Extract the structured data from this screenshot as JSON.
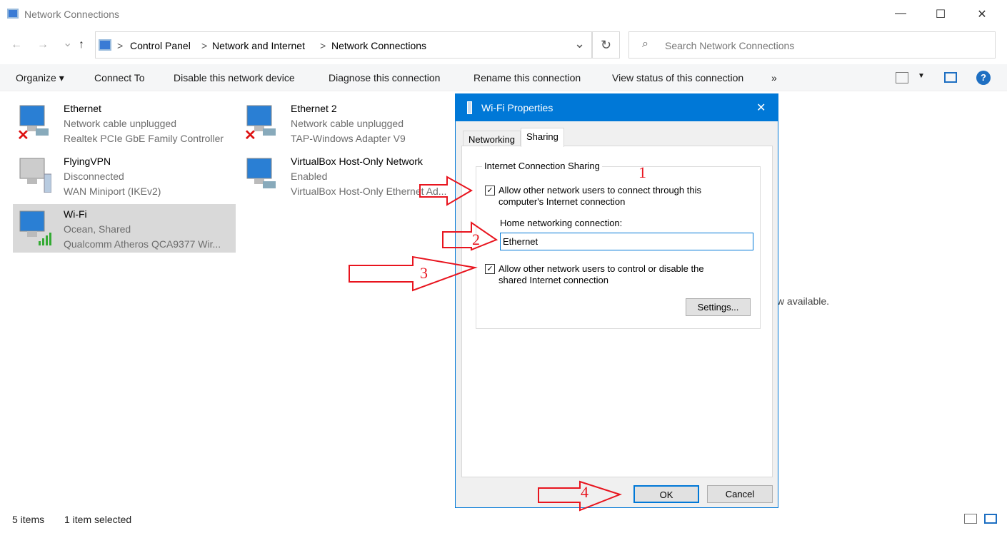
{
  "window": {
    "title": "Network Connections",
    "minimize": "—",
    "maximize": "☐",
    "close": "✕"
  },
  "nav": {
    "back": "←",
    "forward": "→",
    "down": "⌄",
    "up": "↑"
  },
  "address": {
    "crumbs": [
      "Control Panel",
      "Network and Internet",
      "Network Connections"
    ],
    "sep": ">",
    "dropdown": "⌄",
    "refresh": "↻"
  },
  "search": {
    "placeholder": "Search Network Connections",
    "icon": "search-icon"
  },
  "toolbar": {
    "items": [
      "Organize ▾",
      "Connect To",
      "Disable this network device",
      "Diagnose this connection",
      "Rename this connection",
      "View status of this connection",
      "»"
    ],
    "help": "?"
  },
  "connections": [
    {
      "name": "Ethernet",
      "status": "Network cable unplugged",
      "device": "Realtek PCIe GbE Family Controller",
      "icon": "wired-disconnected"
    },
    {
      "name": "Ethernet 2",
      "status": "Network cable unplugged",
      "device": "TAP-Windows Adapter V9",
      "icon": "wired-disconnected"
    },
    {
      "name": "FlyingVPN",
      "status": "Disconnected",
      "device": "WAN Miniport (IKEv2)",
      "icon": "vpn"
    },
    {
      "name": "VirtualBox Host-Only Network",
      "status": "Enabled",
      "device": "VirtualBox Host-Only Ethernet Ad...",
      "icon": "wired"
    },
    {
      "name": "Wi-Fi",
      "status": "Ocean, Shared",
      "device": "Qualcomm Atheros QCA9377 Wir...",
      "icon": "wifi",
      "selected": true
    }
  ],
  "preview_text": "No preview available.",
  "statusbar": {
    "count": "5 items",
    "selected": "1 item selected"
  },
  "dialog": {
    "title": "Wi-Fi Properties",
    "tabs": [
      "Networking",
      "Sharing"
    ],
    "active_tab": "Sharing",
    "group_title": "Internet Connection Sharing",
    "allow_connect": {
      "line1": "Allow other network users to connect through this",
      "line2": "computer's Internet connection",
      "checked": true
    },
    "home_label": "Home networking connection:",
    "home_value": "Ethernet",
    "allow_control": {
      "line1": "Allow other network users to control or disable the",
      "line2": "shared Internet connection",
      "checked": true
    },
    "settings": "Settings...",
    "ok": "OK",
    "cancel": "Cancel",
    "check": "✓"
  },
  "annotations": {
    "labels": [
      "1",
      "2",
      "3",
      "4"
    ],
    "color": "#e8141e"
  },
  "colors": {
    "accent": "#0078d7",
    "selection": "#d9d9d9"
  }
}
